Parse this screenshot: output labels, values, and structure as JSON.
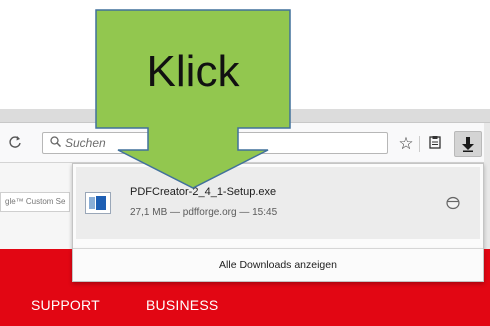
{
  "toolbar": {
    "reload_icon": "reload-icon",
    "search_placeholder": "Suchen",
    "bookmark_icon": "star-icon",
    "library_icon": "clipboard-icon",
    "downloads_icon": "download-arrow-icon"
  },
  "page": {
    "custom_search_text": "gle™ Custom Se",
    "nav_items": [
      "SUPPORT",
      "BUSINESS"
    ],
    "brand_color": "#e20613"
  },
  "downloads_panel": {
    "item": {
      "filename": "PDFCreator-2_4_1-Setup.exe",
      "info": "27,1 MB — pdfforge.org — 15:45"
    },
    "show_all_label": "Alle Downloads anzeigen"
  },
  "annotation": {
    "label": "Klick",
    "fill_color": "#92c74f",
    "border_color": "#41719c"
  }
}
